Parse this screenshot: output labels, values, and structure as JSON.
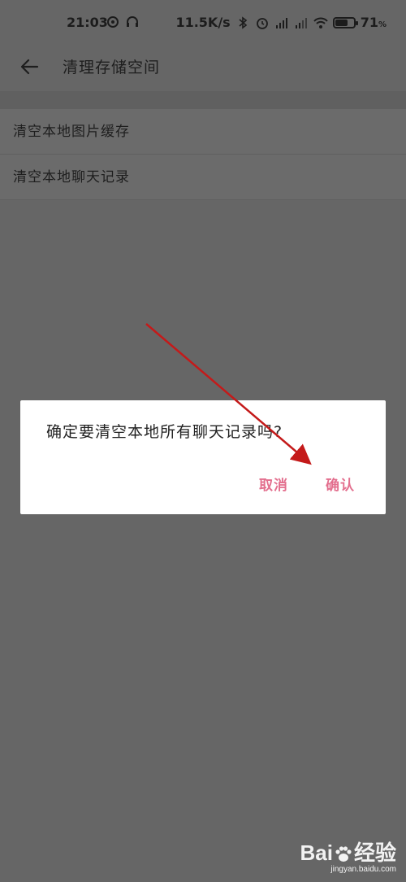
{
  "status_bar": {
    "time": "21:03",
    "network_speed": "11.5K/s",
    "battery_level": 71,
    "battery_label": "71",
    "battery_unit": "%",
    "icons": [
      "sync-icon",
      "headset-icon",
      "bluetooth-icon",
      "alarm-icon",
      "signal-hd-icon",
      "signal-hd-icon",
      "wifi-icon",
      "battery-icon"
    ]
  },
  "app_bar": {
    "title": "清理存储空间",
    "back_icon": "arrow-left-icon"
  },
  "list": {
    "items": [
      {
        "label": "清空本地图片缓存"
      },
      {
        "label": "清空本地聊天记录"
      }
    ]
  },
  "dialog": {
    "message": "确定要清空本地所有聊天记录吗?",
    "cancel_label": "取消",
    "confirm_label": "确认",
    "accent_color": "#e36f8e"
  },
  "annotation": {
    "color": "#c41a1a",
    "points_to": "confirm-button"
  },
  "watermark": {
    "logo_text_1": "Bai",
    "logo_text_2": "经验",
    "url": "jingyan.baidu.com"
  },
  "colors": {
    "overlay_background": "#666666",
    "dialog_background": "#ffffff"
  }
}
